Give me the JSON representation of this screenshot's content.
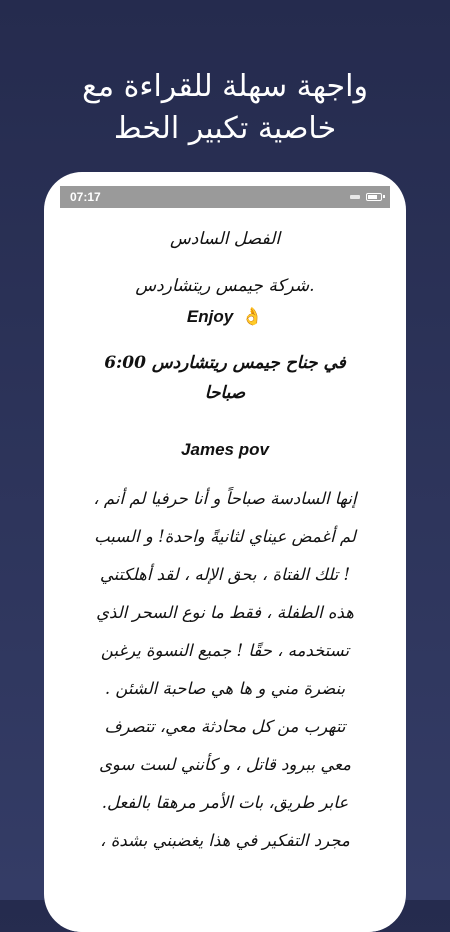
{
  "promo": {
    "headline_line1": "واجهة سهلة للقراءة مع",
    "headline_line2": "خاصية تكبير الخط"
  },
  "status_bar": {
    "time": "07:17"
  },
  "reader": {
    "chapter_title": "الفصل السادس",
    "company_line": ".شركة جيمس ريتشاردس",
    "enjoy_text": "Enjoy",
    "enjoy_emoji": "👌",
    "time_line": "في جناح جيمس ريتشاردس 6:00 صباحا",
    "pov_line": "James pov",
    "body_lines": [
      "إنها السادسة صباحاً و أنا حرفيا لم أنم ،",
      "لم أغمض عيناي لثانيةً واحدة! و السبب",
      "! تلك الفتاة ، بحق الإله ، لقد أهلكتني",
      "هذه الطفلة ، فقط ما نوع السحر الذي",
      "تستخدمه ، حقًا ! جميع النسوة يرغبن",
      "بنضرة مني و ها هي صاحبة الشئن .",
      "تتهرب من كل محادثة معي، تتصرف",
      "معي ببرود قاتل ، و كأنني لست سوى",
      "عابر طريق، بات الأمر مرهقا بالفعل.",
      "مجرد التفكير في هذا يغضبني بشدة ،"
    ]
  }
}
